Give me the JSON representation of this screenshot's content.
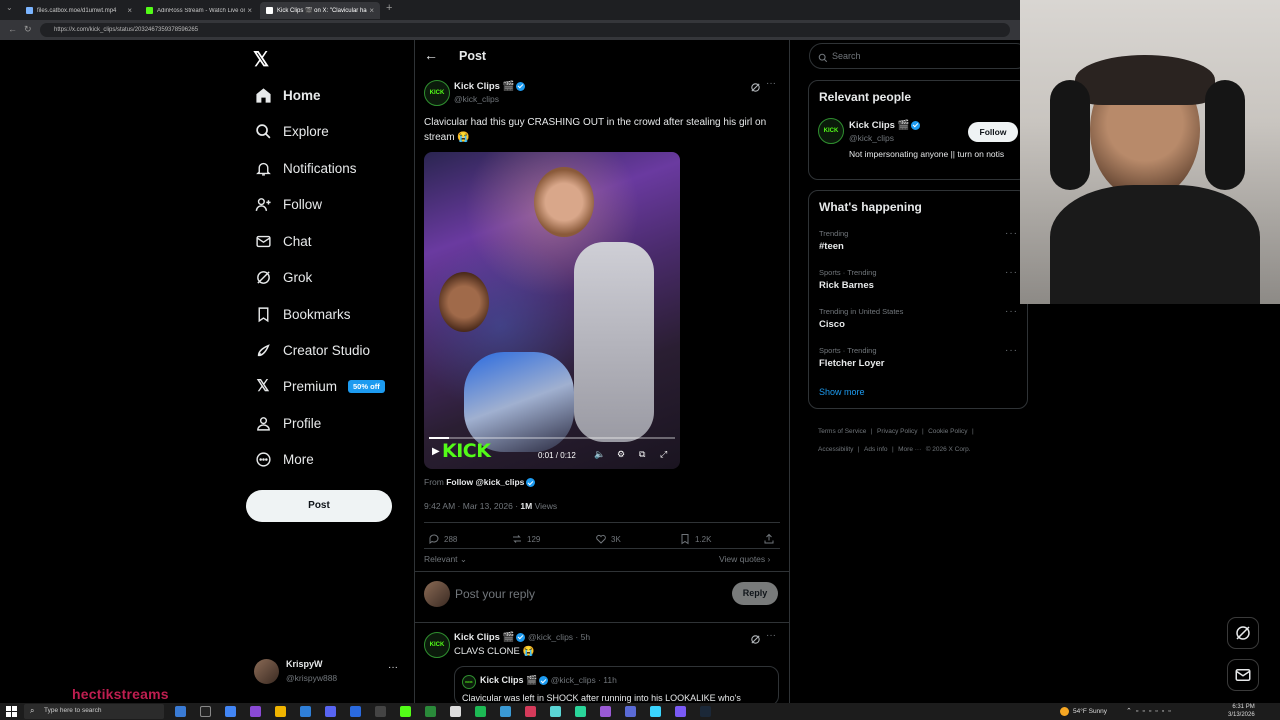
{
  "browser": {
    "tabs": [
      {
        "label": "files.catbox.moe/d1umwt.mp4",
        "close": "×"
      },
      {
        "label": "AdinRoss Stream - Watch Live on Kick",
        "close": "×"
      },
      {
        "label": "Kick Clips 🎬 on X: \"Clavicular had this guy...",
        "close": "×"
      }
    ],
    "new_tab": "+",
    "url": "https://x.com/kick_clips/status/2032467359378596265"
  },
  "sidebar": {
    "logo": "𝕏",
    "items": [
      {
        "label": "Home",
        "icon": "home-icon"
      },
      {
        "label": "Explore",
        "icon": "search-icon"
      },
      {
        "label": "Notifications",
        "icon": "bell-icon"
      },
      {
        "label": "Follow",
        "icon": "person-plus-icon"
      },
      {
        "label": "Chat",
        "icon": "mail-icon"
      },
      {
        "label": "Grok",
        "icon": "grok-icon"
      },
      {
        "label": "Bookmarks",
        "icon": "bookmark-icon"
      },
      {
        "label": "Creator Studio",
        "icon": "rocket-icon"
      },
      {
        "label": "Premium",
        "icon": "x-icon",
        "badge": "50% off"
      },
      {
        "label": "Profile",
        "icon": "person-icon"
      },
      {
        "label": "More",
        "icon": "more-circle-icon"
      }
    ],
    "post_button": "Post",
    "account": {
      "name": "KrispyW",
      "handle": "@krispyw888",
      "more": "···"
    }
  },
  "main": {
    "back": "←",
    "title": "Post",
    "post": {
      "author": "Kick Clips 🎬",
      "handle": "@kick_clips",
      "text": "Clavicular had this guy CRASHING OUT in the crowd after stealing his girl on stream 😭",
      "video": {
        "brand": "KICK",
        "time": "0:01 / 0:12",
        "progress": 0.08
      },
      "from_prefix": "From ",
      "from_link": "Follow @kick_clips",
      "time": "9:42 AM · Mar 13, 2026 · ",
      "views_count": "1M",
      "views_label": " Views",
      "actions": {
        "replies": "288",
        "reposts": "129",
        "likes": "3K",
        "bookmarks": "1.2K"
      },
      "relevant": "Relevant ⌄",
      "view_quotes": "View quotes ›"
    },
    "reply": {
      "placeholder": "Post your reply",
      "button": "Reply"
    },
    "next_post": {
      "author": "Kick Clips 🎬",
      "handle": "@kick_clips · 5h",
      "text": "CLAVS CLONE 😭",
      "quoted_author": "Kick Clips 🎬",
      "quoted_handle": "@kick_clips · 11h",
      "quoted_text": "Clavicular was left in SHOCK after running into his LOOKALIKE who's"
    }
  },
  "right": {
    "search_placeholder": "Search",
    "relevant_title": "Relevant people",
    "person": {
      "name": "Kick Clips 🎬",
      "handle": "@kick_clips",
      "bio": "Not impersonating anyone || turn on notis",
      "follow": "Follow"
    },
    "happening_title": "What's happening",
    "trends": [
      {
        "category": "Trending",
        "name": "#teen"
      },
      {
        "category": "Sports · Trending",
        "name": "Rick Barnes"
      },
      {
        "category": "Trending in United States",
        "name": "Cisco"
      },
      {
        "category": "Sports · Trending",
        "name": "Fletcher Loyer"
      }
    ],
    "show_more": "Show more",
    "footer": [
      "Terms of Service",
      "Privacy Policy",
      "Cookie Policy",
      "Accessibility",
      "Ads info",
      "More ···",
      "© 2026 X Corp."
    ]
  },
  "overlay": {
    "watermark": "hectikstreams"
  },
  "taskbar": {
    "search": "Type here to search",
    "weather": "54°F Sunny",
    "clock_time": "6:31 PM",
    "clock_date": "3/13/2026"
  },
  "colors": {
    "accent": "#1d9bf0",
    "kick_green": "#53fc18",
    "bg": "#000000"
  }
}
